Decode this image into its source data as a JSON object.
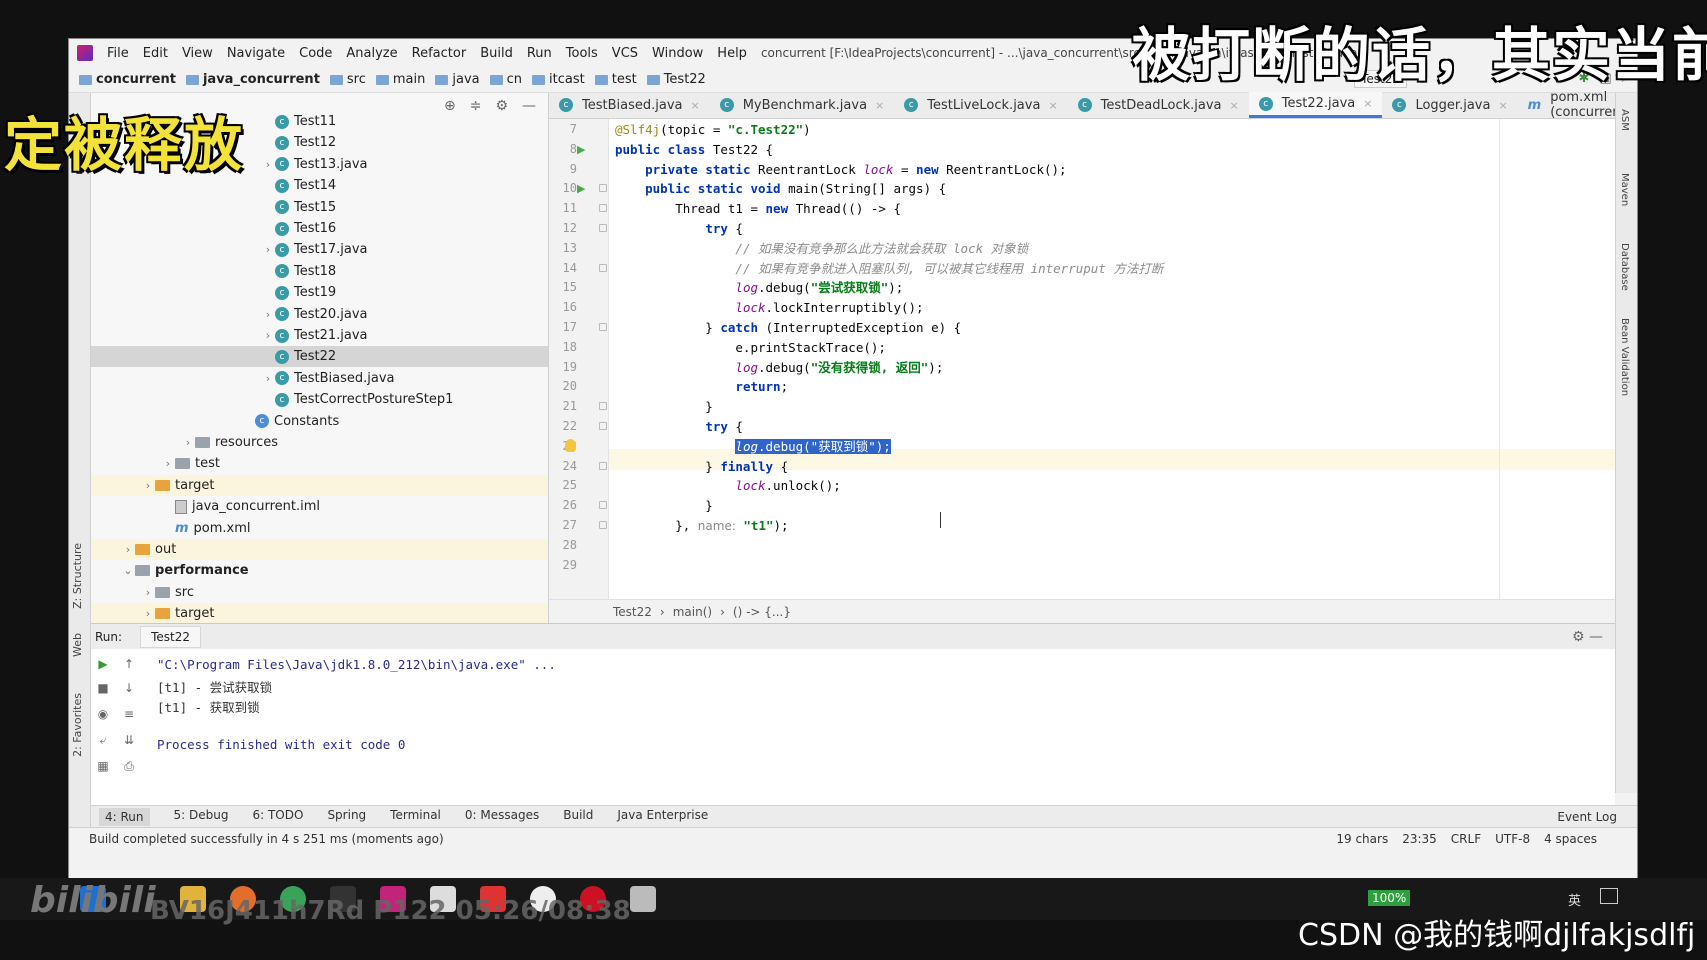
{
  "overlays": {
    "top_right_caption": "被打断的话，其实当前",
    "top_left_caption": "定被释放",
    "watermark": "CSDN @我的钱啊djlfakjsdlfj",
    "bili_logo": "bilibili",
    "bili_id": "BV16J411h7Rd P122 05:26/08:38"
  },
  "menu": {
    "items": [
      "File",
      "Edit",
      "View",
      "Navigate",
      "Code",
      "Analyze",
      "Refactor",
      "Build",
      "Run",
      "Tools",
      "VCS",
      "Window",
      "Help"
    ],
    "title": "concurrent [F:\\IdeaProjects\\concurrent] - ...\\java_concurrent\\src\\main\\java\\cn\\itcast\\test\\Test22.java"
  },
  "breadcrumb": [
    "concurrent",
    "java_concurrent",
    "src",
    "main",
    "java",
    "cn",
    "itcast",
    "test",
    "Test22"
  ],
  "run_config": "Test22",
  "project_tree": [
    {
      "label": "Test11",
      "type": "class",
      "indent": 170,
      "chev": false
    },
    {
      "label": "Test12",
      "type": "class",
      "indent": 170,
      "chev": false
    },
    {
      "label": "Test13.java",
      "type": "class",
      "indent": 170,
      "chev": true
    },
    {
      "label": "Test14",
      "type": "class",
      "indent": 170,
      "chev": false
    },
    {
      "label": "Test15",
      "type": "class",
      "indent": 170,
      "chev": false
    },
    {
      "label": "Test16",
      "type": "class",
      "indent": 170,
      "chev": false
    },
    {
      "label": "Test17.java",
      "type": "class",
      "indent": 170,
      "chev": true
    },
    {
      "label": "Test18",
      "type": "class",
      "indent": 170,
      "chev": false
    },
    {
      "label": "Test19",
      "type": "class",
      "indent": 170,
      "chev": false
    },
    {
      "label": "Test20.java",
      "type": "class",
      "indent": 170,
      "chev": true
    },
    {
      "label": "Test21.java",
      "type": "class",
      "indent": 170,
      "chev": true
    },
    {
      "label": "Test22",
      "type": "class",
      "indent": 170,
      "chev": false,
      "selected": true
    },
    {
      "label": "TestBiased.java",
      "type": "class",
      "indent": 170,
      "chev": true
    },
    {
      "label": "TestCorrectPostureStep1",
      "type": "class",
      "indent": 170,
      "chev": false
    },
    {
      "label": "Constants",
      "type": "class-blue",
      "indent": 150,
      "chev": false
    },
    {
      "label": "resources",
      "type": "folder-gray",
      "indent": 90,
      "chev": true
    },
    {
      "label": "test",
      "type": "folder-gray",
      "indent": 70,
      "chev": true
    },
    {
      "label": "target",
      "type": "folder-orange",
      "indent": 50,
      "chev": true,
      "yellow": true
    },
    {
      "label": "java_concurrent.iml",
      "type": "iml",
      "indent": 70,
      "chev": false
    },
    {
      "label": "pom.xml",
      "type": "maven",
      "indent": 70,
      "chev": false
    },
    {
      "label": "out",
      "type": "folder-orange",
      "indent": 30,
      "chev": true,
      "yellow": true
    },
    {
      "label": "performance",
      "type": "folder-gray",
      "indent": 30,
      "chev": "open",
      "bold": true
    },
    {
      "label": "src",
      "type": "folder-gray",
      "indent": 50,
      "chev": true
    },
    {
      "label": "target",
      "type": "folder-orange",
      "indent": 50,
      "chev": true,
      "yellow": true
    }
  ],
  "editor_tabs": [
    {
      "label": "TestBiased.java",
      "active": false
    },
    {
      "label": "MyBenchmark.java",
      "active": false
    },
    {
      "label": "TestLiveLock.java",
      "active": false
    },
    {
      "label": "TestDeadLock.java",
      "active": false
    },
    {
      "label": "Test22.java",
      "active": true
    },
    {
      "label": "Logger.java",
      "active": false
    },
    {
      "label": "pom.xml (concurrent)",
      "active": false
    }
  ],
  "code": {
    "line_numbers": [
      "7",
      "8",
      "9",
      "10",
      "11",
      "12",
      "13",
      "14",
      "15",
      "16",
      "17",
      "18",
      "19",
      "20",
      "21",
      "22",
      "23",
      "24",
      "25",
      "26",
      "27",
      "28",
      "29"
    ],
    "lines_html": [
      "<span class=\"an\">@Slf4j</span>(topic = <span class=\"st\">\"c.Test22\"</span>)",
      "<span class=\"kw\">public class</span> Test22 {",
      "    <span class=\"kw\">private static</span> ReentrantLock <span class=\"it\">lock</span> = <span class=\"kw\">new</span> ReentrantLock();",
      "    <span class=\"kw\">public static void</span> main(String[] args) {",
      "        Thread t1 = <span class=\"kw\">new</span> Thread(() -> {",
      "            <span class=\"kw\">try</span> {",
      "                <span class=\"cm\">// 如果没有竞争那么此方法就会获取 lock 对象锁</span>",
      "                <span class=\"cm\">// 如果有竞争就进入阻塞队列, 可以被其它线程用 interruput 方法打断</span>",
      "                <span class=\"it\">log</span>.debug(<span class=\"st\">\"尝试获取锁\"</span>);",
      "                <span class=\"it\">lock</span>.lockInterruptibly();",
      "            } <span class=\"kw\">catch</span> (InterruptedException e) {",
      "                e.printStackTrace();",
      "                <span class=\"it\">log</span>.debug(<span class=\"st\">\"没有获得锁, 返回\"</span>);",
      "                <span class=\"kw\">return</span>;",
      "            }",
      "            <span class=\"kw\">try</span> {",
      "                <span class=\"selhl\"><span style=\"font-style:italic\">log</span>.debug(\"获取到锁\");</span>",
      "            } <span class=\"kw\">finally</span> {",
      "                <span class=\"it\">lock</span>.unlock();",
      "            }",
      "        }, <span class=\"hint\">name:</span> <span class=\"st\">\"t1\"</span>);",
      "",
      ""
    ]
  },
  "editor_breadcrumb": [
    "Test22",
    "main()",
    "() -> {...}"
  ],
  "run": {
    "label": "Run:",
    "tab": "Test22",
    "output": [
      "\"C:\\Program Files\\Java\\jdk1.8.0_212\\bin\\java.exe\" ...",
      "[t1] - 尝试获取锁",
      "[t1] - 获取到锁",
      "",
      "Process finished with exit code 0"
    ]
  },
  "bottom_tabs": [
    "4: Run",
    "5: Debug",
    "6: TODO",
    "Spring",
    "Terminal",
    "0: Messages",
    "Build",
    "Java Enterprise"
  ],
  "event_log": "Event Log",
  "status": {
    "message": "Build completed successfully in 4 s 251 ms (moments ago)",
    "chars": "19 chars",
    "position": "23:35",
    "line_sep": "CRLF",
    "encoding": "UTF-8",
    "indent": "4 spaces"
  },
  "side_labels": {
    "left": [
      "Z: Structure",
      "Web",
      "2: Favorites"
    ],
    "right": [
      "ASM",
      "Maven",
      "Database",
      "Bean Validation"
    ]
  },
  "battery": "100%",
  "ime": "英"
}
